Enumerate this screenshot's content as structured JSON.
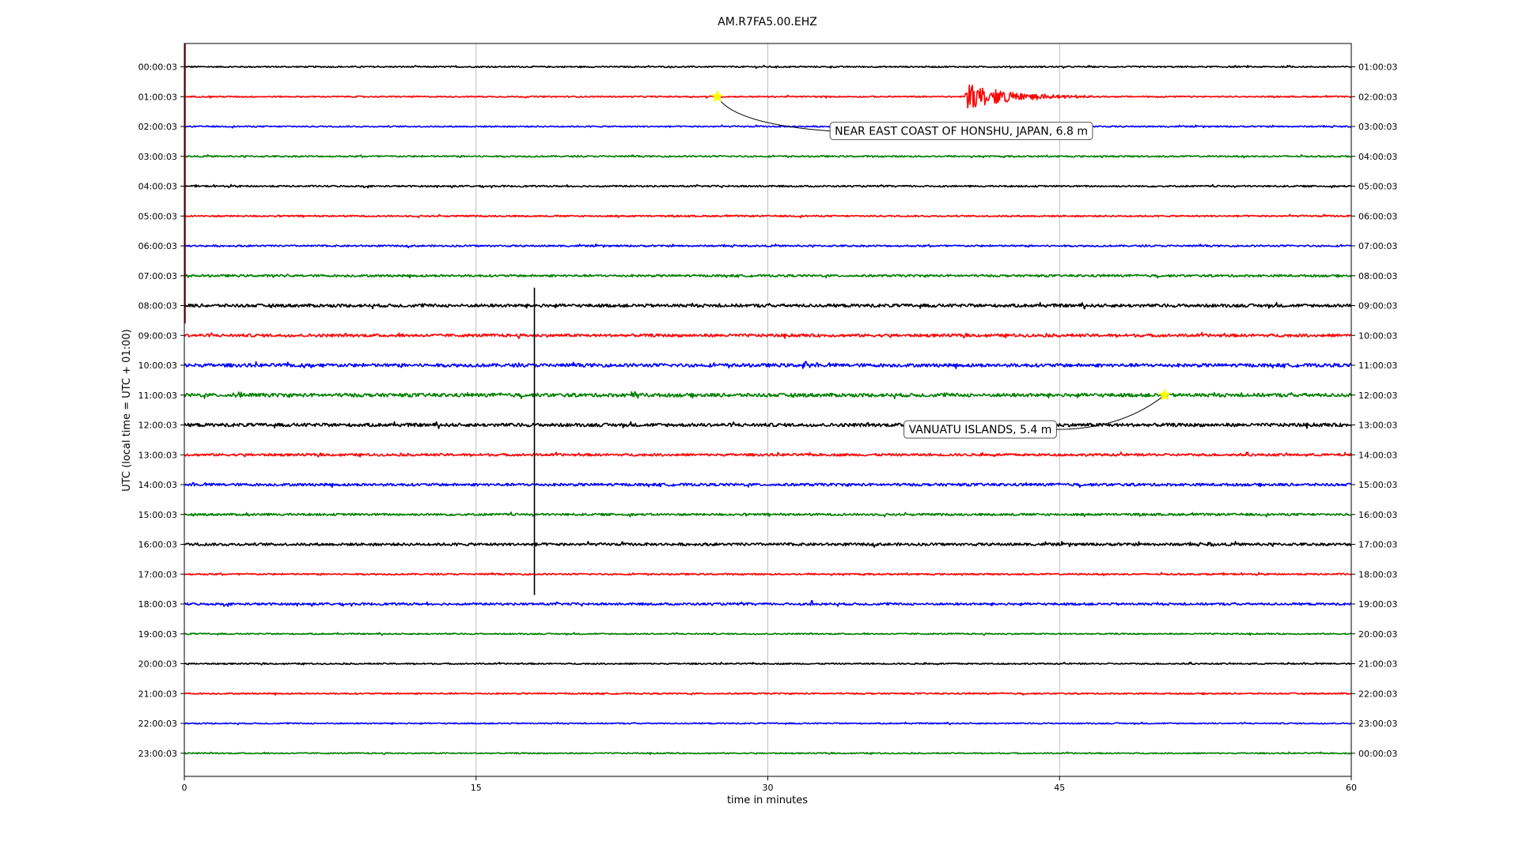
{
  "chart_data": {
    "type": "line",
    "title": "AM.R7FA5.00.EHZ",
    "xlabel": "time in minutes",
    "ylabel": "UTC (local time = UTC + 01:00)",
    "xlim": [
      0,
      60
    ],
    "xticks": [
      0,
      15,
      30,
      45,
      60
    ],
    "grid_x": true,
    "trace_colors": [
      "#000000",
      "#ff0000",
      "#0000ff",
      "#008000"
    ],
    "star_color": "#ffff00",
    "left_labels": [
      "00:00:03",
      "01:00:03",
      "02:00:03",
      "03:00:03",
      "04:00:03",
      "05:00:03",
      "06:00:03",
      "07:00:03",
      "08:00:03",
      "09:00:03",
      "10:00:03",
      "11:00:03",
      "12:00:03",
      "13:00:03",
      "14:00:03",
      "15:00:03",
      "16:00:03",
      "17:00:03",
      "18:00:03",
      "19:00:03",
      "20:00:03",
      "21:00:03",
      "22:00:03",
      "23:00:03"
    ],
    "right_labels": [
      "01:00:03",
      "02:00:03",
      "03:00:03",
      "04:00:03",
      "05:00:03",
      "06:00:03",
      "07:00:03",
      "08:00:03",
      "09:00:03",
      "10:00:03",
      "11:00:03",
      "12:00:03",
      "13:00:03",
      "14:00:03",
      "15:00:03",
      "16:00:03",
      "17:00:03",
      "18:00:03",
      "19:00:03",
      "20:00:03",
      "21:00:03",
      "22:00:03",
      "23:00:03",
      "00:00:03"
    ],
    "trace_noise": [
      0.12,
      0.12,
      0.12,
      0.14,
      0.14,
      0.14,
      0.15,
      0.2,
      0.28,
      0.26,
      0.3,
      0.32,
      0.3,
      0.22,
      0.24,
      0.2,
      0.24,
      0.14,
      0.2,
      0.12,
      0.12,
      0.13,
      0.11,
      0.11
    ],
    "bursts": [
      {
        "trace": 1,
        "minute": 40.2,
        "amplitude": 2.4,
        "decay_minutes": 2.2
      },
      {
        "trace": 7,
        "minute": 4.6,
        "amplitude": 0.5,
        "decay_minutes": 0.4
      },
      {
        "trace": 10,
        "minute": 5.8,
        "amplitude": 0.6,
        "decay_minutes": 0.5
      },
      {
        "trace": 10,
        "minute": 31.8,
        "amplitude": 0.75,
        "decay_minutes": 0.2
      },
      {
        "trace": 11,
        "minute": 2.5,
        "amplitude": 0.55,
        "decay_minutes": 0.5
      },
      {
        "trace": 11,
        "minute": 23.0,
        "amplitude": 0.45,
        "decay_minutes": 0.3
      },
      {
        "trace": 15,
        "minute": 3.0,
        "amplitude": 0.5,
        "decay_minutes": 0.4
      },
      {
        "trace": 16,
        "minute": 52.5,
        "amplitude": 0.55,
        "decay_minutes": 0.2
      },
      {
        "trace": 18,
        "minute": 32.2,
        "amplitude": 0.8,
        "decay_minutes": 0.2
      }
    ],
    "spike": {
      "minute": 18.0,
      "trace_start": 7.4,
      "trace_end": 17.7
    },
    "events": [
      {
        "label": "NEAR EAST COAST OF HONSHU, JAPAN, 6.8 m",
        "trace": 1,
        "minute": 27.4,
        "label_trace": 2.15,
        "label_minute": 33.2
      },
      {
        "label": "VANUATU ISLANDS, 5.4 m",
        "trace": 11,
        "minute": 50.4,
        "label_trace": 12.15,
        "label_minute": 37.0
      }
    ]
  }
}
